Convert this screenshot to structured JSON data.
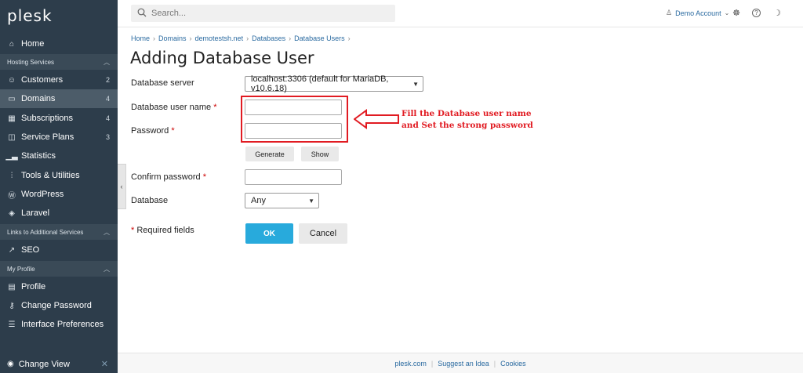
{
  "sidebar": {
    "logo": "plesk",
    "home": "Home",
    "groups": {
      "hosting": "Hosting Services",
      "links": "Links to Additional Services",
      "profile": "My Profile"
    },
    "items": {
      "customers": {
        "label": "Customers",
        "count": "2"
      },
      "domains": {
        "label": "Domains",
        "count": "4"
      },
      "subscriptions": {
        "label": "Subscriptions",
        "count": "4"
      },
      "service_plans": {
        "label": "Service Plans",
        "count": "3"
      },
      "statistics": {
        "label": "Statistics"
      },
      "tools": {
        "label": "Tools & Utilities"
      },
      "wordpress": {
        "label": "WordPress"
      },
      "laravel": {
        "label": "Laravel"
      },
      "seo": {
        "label": "SEO"
      },
      "profile": {
        "label": "Profile"
      },
      "change_password": {
        "label": "Change Password"
      },
      "interface_prefs": {
        "label": "Interface Preferences"
      }
    },
    "change_view": "Change View"
  },
  "header": {
    "search_placeholder": "Search...",
    "account": "Demo Account"
  },
  "breadcrumb": [
    "Home",
    "Domains",
    "demotestsh.net",
    "Databases",
    "Database Users"
  ],
  "page_title": "Adding Database User",
  "form": {
    "server_label": "Database server",
    "server_value": "localhost:3306 (default for MariaDB, v10.6.18)",
    "username_label": "Database user name",
    "password_label": "Password",
    "generate": "Generate",
    "show": "Show",
    "confirm_label": "Confirm password",
    "database_label": "Database",
    "database_value": "Any",
    "required_asterisk": "*",
    "required_note": "Required fields",
    "ok": "OK",
    "cancel": "Cancel"
  },
  "annotation": {
    "line1": "Fill the Database user name",
    "line2": "and Set the strong password",
    "color": "#e11b22"
  },
  "footer": [
    "plesk.com",
    "Suggest an Idea",
    "Cookies"
  ]
}
